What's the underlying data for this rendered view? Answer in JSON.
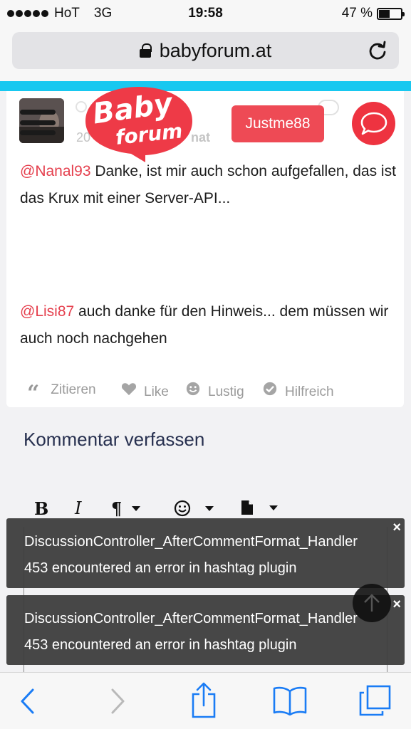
{
  "status_bar": {
    "carrier": "HoT",
    "network": "3G",
    "time": "19:58",
    "battery_percent": "47 %",
    "battery_level": 0.47
  },
  "browser": {
    "url": "babyforum.at"
  },
  "post": {
    "logo_line1": "Baby",
    "logo_line2": "forum",
    "username_button": "Justme88",
    "meta_date_fragment": "20",
    "meta_format_fragment": "nat",
    "paragraph1_mention": "@Nanal93",
    "paragraph1_text": " Danke, ist mir auch schon aufgefallen, das ist das Krux mit einer Server-API...",
    "paragraph2_mention": "@Lisi87",
    "paragraph2_text": " auch danke für den Hinweis... dem müssen wir auch noch nachgehen",
    "reactions": {
      "quote": "Zitieren",
      "like": "Like",
      "funny": "Lustig",
      "helpful": "Hilfreich"
    }
  },
  "comment_section": {
    "title": "Kommentar verfassen",
    "toolbar": {
      "bold": "B",
      "italic": "I",
      "paragraph": "¶"
    }
  },
  "toasts": [
    {
      "line1": "DiscussionController_AfterCommentFormat_Handler",
      "line2": "453 encountered an error in hashtag plugin",
      "close": "×"
    },
    {
      "line1": "DiscussionController_AfterCommentFormat_Handler",
      "line2": "453 encountered an error in hashtag plugin",
      "close": "×"
    }
  ],
  "colors": {
    "accent_red": "#ee4a55",
    "mention_red": "#e5404e",
    "brand_teal": "#18c8f0",
    "title_navy": "#27304f"
  },
  "icons": {
    "menu": "hamburger-icon",
    "chat": "speech-bubble-icon",
    "quote": "quote-icon",
    "like": "heart-icon",
    "funny": "smiley-icon",
    "helpful": "checkmark-circle-icon",
    "scroll_top": "arrow-up-icon",
    "back": "chevron-left-icon",
    "forward": "chevron-right-icon",
    "share": "share-icon",
    "bookmarks": "book-icon",
    "tabs": "tabs-icon"
  }
}
